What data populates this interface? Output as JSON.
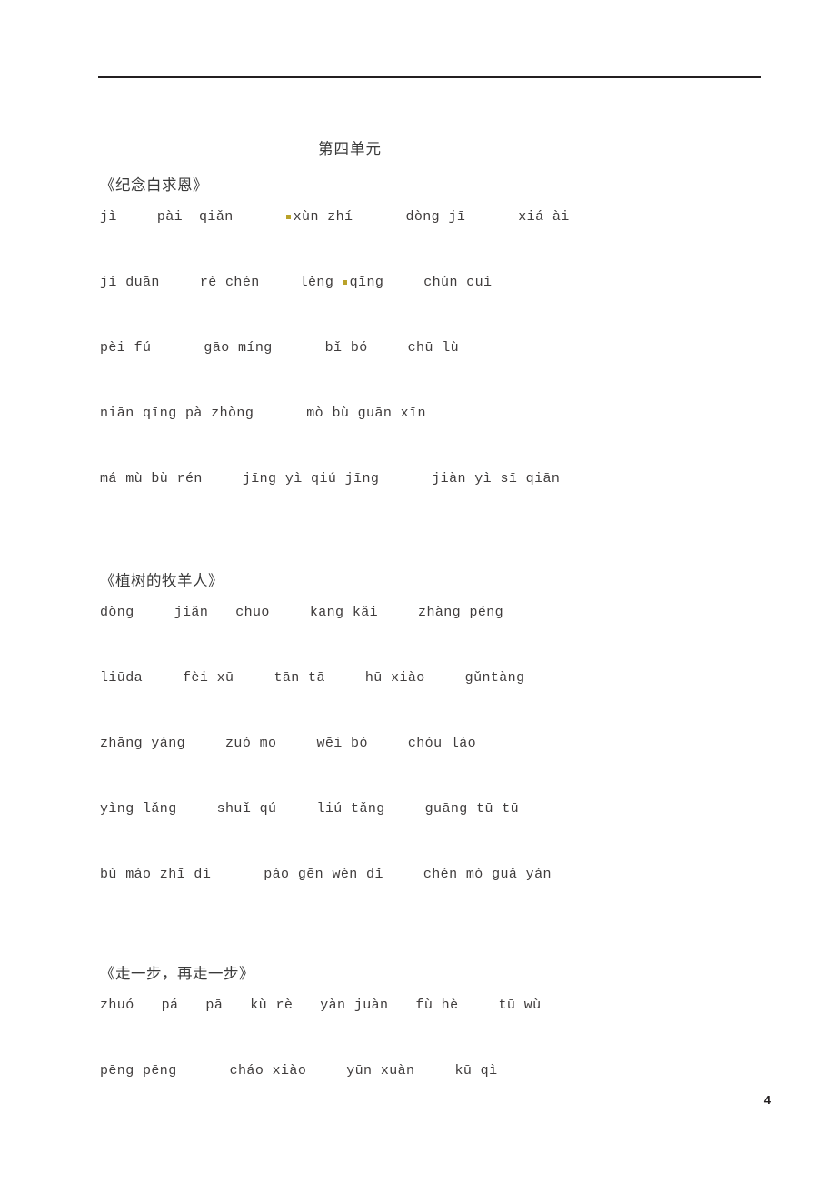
{
  "document": {
    "unit_title": "第四单元",
    "page_number": "4",
    "marker_color": "#b9a22a",
    "rule_color": "#231f20"
  },
  "sections": [
    {
      "heading": "《纪念白求恩》",
      "lines": [
        {
          "groups": [
            {
              "text": "jì",
              "gap_after": "lg",
              "marker": false
            },
            {
              "text": "pài",
              "gap_after": "sm",
              "marker": false
            },
            {
              "text": "qiǎn",
              "gap_after": "xl",
              "marker": false
            },
            {
              "text": "xùn zhí",
              "gap_after": "xl",
              "marker": true
            },
            {
              "text": "dòng jī",
              "gap_after": "xl",
              "marker": false
            },
            {
              "text": "xiá ài",
              "gap_after": "",
              "marker": false
            }
          ]
        },
        {
          "groups": [
            {
              "text": "jí duān",
              "gap_after": "lg",
              "marker": false
            },
            {
              "text": "rè chén",
              "gap_after": "lg",
              "marker": false
            },
            {
              "text": "lěng ",
              "gap_after": "",
              "marker": false
            },
            {
              "text": "qīng",
              "gap_after": "lg",
              "marker": true
            },
            {
              "text": "chún cuì",
              "gap_after": "",
              "marker": false
            }
          ]
        },
        {
          "groups": [
            {
              "text": "pèi fú",
              "gap_after": "xl",
              "marker": false
            },
            {
              "text": "gāo míng",
              "gap_after": "xl",
              "marker": false
            },
            {
              "text": "bǐ bó",
              "gap_after": "lg",
              "marker": false
            },
            {
              "text": "chū lù",
              "gap_after": "",
              "marker": false
            }
          ]
        },
        {
          "groups": [
            {
              "text": "niān qīng pà zhòng",
              "gap_after": "xl",
              "marker": false
            },
            {
              "text": "mò bù guān xīn",
              "gap_after": "",
              "marker": false
            }
          ]
        },
        {
          "groups": [
            {
              "text": "má mù bù rén",
              "gap_after": "lg",
              "marker": false
            },
            {
              "text": "jīng yì qiú jīng",
              "gap_after": "xl",
              "marker": false
            },
            {
              "text": "jiàn yì sī qiān",
              "gap_after": "",
              "marker": false
            }
          ]
        }
      ]
    },
    {
      "heading": "《植树的牧羊人》",
      "lines": [
        {
          "groups": [
            {
              "text": "dòng",
              "gap_after": "lg",
              "marker": false
            },
            {
              "text": "jiǎn",
              "gap_after": "md",
              "marker": false
            },
            {
              "text": "chuō",
              "gap_after": "lg",
              "marker": false
            },
            {
              "text": "kāng kǎi",
              "gap_after": "lg",
              "marker": false
            },
            {
              "text": "zhàng péng",
              "gap_after": "",
              "marker": false
            }
          ]
        },
        {
          "groups": [
            {
              "text": "liūda",
              "gap_after": "lg",
              "marker": false
            },
            {
              "text": "fèi xū",
              "gap_after": "lg",
              "marker": false
            },
            {
              "text": "tān tā",
              "gap_after": "lg",
              "marker": false
            },
            {
              "text": "hū xiào",
              "gap_after": "lg",
              "marker": false
            },
            {
              "text": "gǔntàng",
              "gap_after": "",
              "marker": false
            }
          ]
        },
        {
          "groups": [
            {
              "text": "zhāng yáng",
              "gap_after": "lg",
              "marker": false
            },
            {
              "text": "zuó mo",
              "gap_after": "lg",
              "marker": false
            },
            {
              "text": "wēi bó",
              "gap_after": "lg",
              "marker": false
            },
            {
              "text": "chóu láo",
              "gap_after": "",
              "marker": false
            }
          ]
        },
        {
          "groups": [
            {
              "text": "yìng lǎng",
              "gap_after": "lg",
              "marker": false
            },
            {
              "text": "shuǐ qú",
              "gap_after": "lg",
              "marker": false
            },
            {
              "text": "liú tǎng",
              "gap_after": "lg",
              "marker": false
            },
            {
              "text": "guāng tū tū",
              "gap_after": "",
              "marker": false
            }
          ]
        },
        {
          "groups": [
            {
              "text": "bù máo zhī dì",
              "gap_after": "xl",
              "marker": false
            },
            {
              "text": "páo gēn wèn dǐ",
              "gap_after": "lg",
              "marker": false
            },
            {
              "text": "chén mò guǎ yán",
              "gap_after": "",
              "marker": false
            }
          ]
        }
      ]
    },
    {
      "heading": "《走一步，再走一步》",
      "lines": [
        {
          "groups": [
            {
              "text": "zhuó",
              "gap_after": "md",
              "marker": false
            },
            {
              "text": "pá",
              "gap_after": "md",
              "marker": false
            },
            {
              "text": "pā",
              "gap_after": "md",
              "marker": false
            },
            {
              "text": "kù rè",
              "gap_after": "md",
              "marker": false
            },
            {
              "text": "yàn juàn",
              "gap_after": "md",
              "marker": false
            },
            {
              "text": "fù hè",
              "gap_after": "lg",
              "marker": false
            },
            {
              "text": "tū wù",
              "gap_after": "",
              "marker": false
            }
          ]
        },
        {
          "groups": [
            {
              "text": "pēng pēng",
              "gap_after": "xl",
              "marker": false
            },
            {
              "text": "cháo xiào",
              "gap_after": "lg",
              "marker": false
            },
            {
              "text": "yūn xuàn",
              "gap_after": "lg",
              "marker": false
            },
            {
              "text": "kū qì",
              "gap_after": "",
              "marker": false
            }
          ]
        }
      ]
    }
  ]
}
